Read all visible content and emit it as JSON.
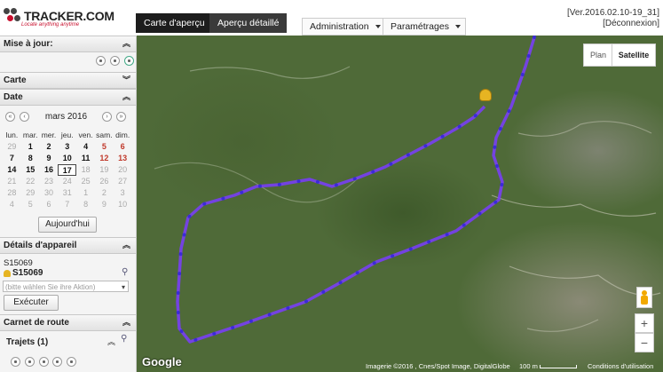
{
  "header": {
    "logo": "TRACKER.COM",
    "tagline": "Locate anything anytime",
    "tabs": [
      {
        "label": "Carte d'aperçu"
      },
      {
        "label": "Aperçu détaillé"
      }
    ],
    "menus": [
      {
        "label": "Administration"
      },
      {
        "label": "Paramétrages"
      }
    ],
    "version": "[Ver.2016.02.10-19_31]",
    "logout": "[Déconnexion]"
  },
  "sidebar": {
    "sections": {
      "update": "Mise à jour:",
      "map": "Carte",
      "date": "Date",
      "device": "Détails d'appareil",
      "log": "Carnet de route"
    },
    "calendar": {
      "month": "mars 2016",
      "dow": [
        "lun.",
        "mar.",
        "mer.",
        "jeu.",
        "ven.",
        "sam.",
        "dim."
      ],
      "weeks": [
        [
          {
            "d": "29",
            "s": "grey"
          },
          {
            "d": "1",
            "s": "bold"
          },
          {
            "d": "2",
            "s": "bold"
          },
          {
            "d": "3",
            "s": "bold"
          },
          {
            "d": "4",
            "s": "bold"
          },
          {
            "d": "5",
            "s": "red"
          },
          {
            "d": "6",
            "s": "red"
          }
        ],
        [
          {
            "d": "7",
            "s": "bold"
          },
          {
            "d": "8",
            "s": "bold"
          },
          {
            "d": "9",
            "s": "bold"
          },
          {
            "d": "10",
            "s": "bold"
          },
          {
            "d": "11",
            "s": "bold"
          },
          {
            "d": "12",
            "s": "red"
          },
          {
            "d": "13",
            "s": "red"
          }
        ],
        [
          {
            "d": "14",
            "s": "bold"
          },
          {
            "d": "15",
            "s": "bold"
          },
          {
            "d": "16",
            "s": "bold"
          },
          {
            "d": "17",
            "s": "today"
          },
          {
            "d": "18",
            "s": "grey"
          },
          {
            "d": "19",
            "s": "grey"
          },
          {
            "d": "20",
            "s": "grey"
          }
        ],
        [
          {
            "d": "21",
            "s": "grey"
          },
          {
            "d": "22",
            "s": "grey"
          },
          {
            "d": "23",
            "s": "grey"
          },
          {
            "d": "24",
            "s": "grey"
          },
          {
            "d": "25",
            "s": "grey"
          },
          {
            "d": "26",
            "s": "grey"
          },
          {
            "d": "27",
            "s": "grey"
          }
        ],
        [
          {
            "d": "28",
            "s": "grey"
          },
          {
            "d": "29",
            "s": "grey"
          },
          {
            "d": "30",
            "s": "grey"
          },
          {
            "d": "31",
            "s": "grey"
          },
          {
            "d": "1",
            "s": "grey"
          },
          {
            "d": "2",
            "s": "grey"
          },
          {
            "d": "3",
            "s": "grey"
          }
        ],
        [
          {
            "d": "4",
            "s": "grey"
          },
          {
            "d": "5",
            "s": "grey"
          },
          {
            "d": "6",
            "s": "grey"
          },
          {
            "d": "7",
            "s": "grey"
          },
          {
            "d": "8",
            "s": "grey"
          },
          {
            "d": "9",
            "s": "grey"
          },
          {
            "d": "10",
            "s": "grey"
          }
        ]
      ],
      "today_button": "Aujourd'hui"
    },
    "device": {
      "id": "S15069",
      "name": "S15069",
      "action_placeholder": "(bitte wählen Sie ihre Aktion)",
      "execute_button": "Exécuter"
    },
    "log": {
      "trips": "Trajets (1)"
    }
  },
  "map": {
    "type_buttons": [
      {
        "label": "Plan"
      },
      {
        "label": "Satellite"
      }
    ],
    "zoom_in": "+",
    "zoom_out": "−",
    "google": "Google",
    "attribution": "Imagerie ©2016 , Cnes/Spot Image, DigitalGlobe",
    "scale": "100 m",
    "terms": "Conditions d'utilisation",
    "route_color": "#7a3cff"
  }
}
